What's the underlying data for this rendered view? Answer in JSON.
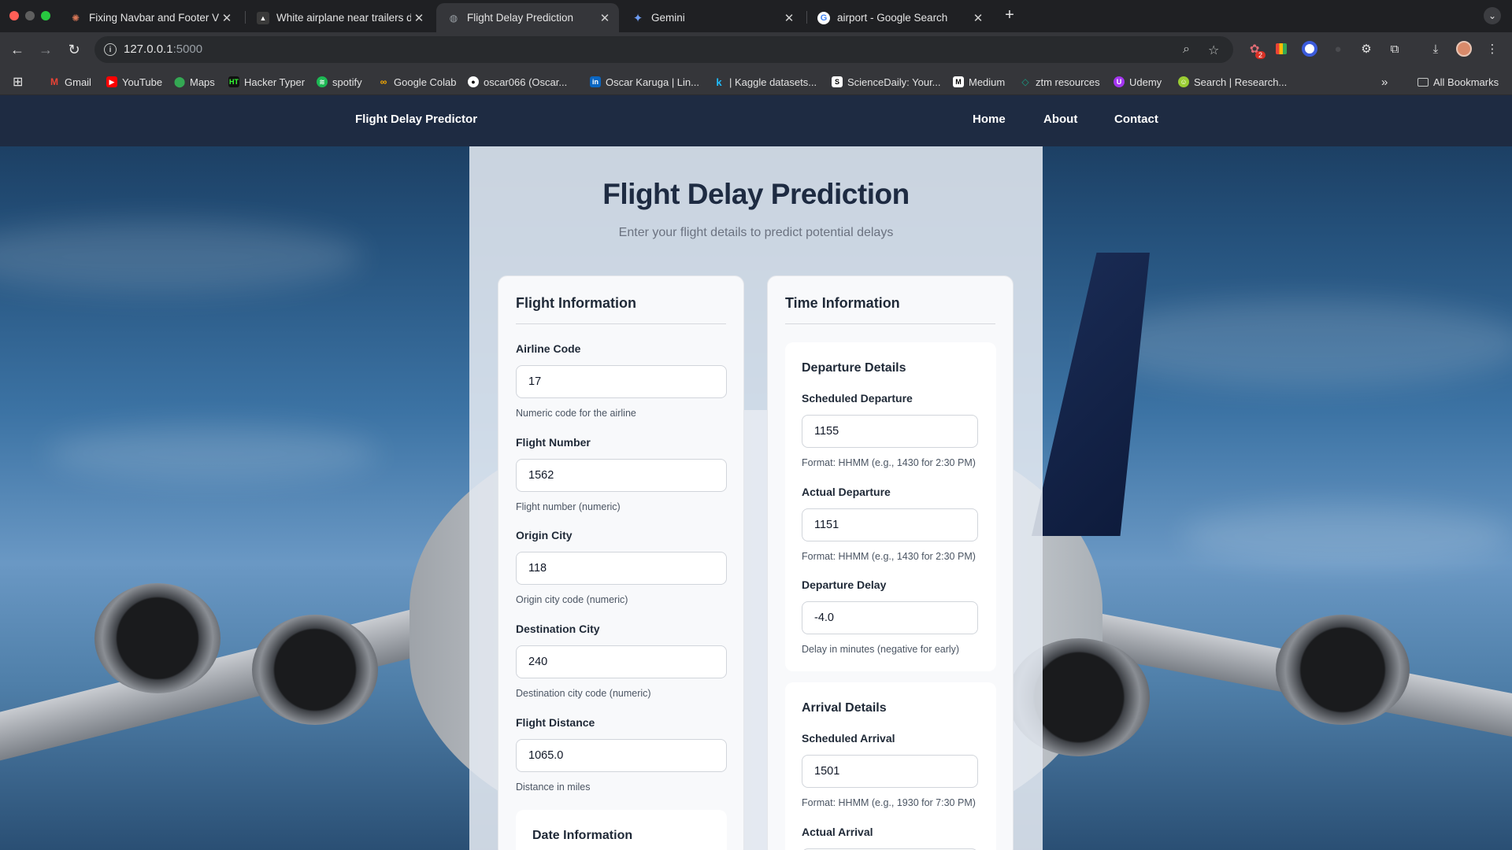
{
  "browser": {
    "tabs": [
      {
        "title": "Fixing Navbar and Footer Visi",
        "favicon": "claude-icon"
      },
      {
        "title": "White airplane near trailers d",
        "favicon": "image-icon"
      },
      {
        "title": "Flight Delay Prediction",
        "favicon": "globe-icon",
        "active": true
      },
      {
        "title": "Gemini",
        "favicon": "gemini-icon"
      },
      {
        "title": "airport - Google Search",
        "favicon": "google-icon"
      }
    ],
    "url_host": "127.0.0.1",
    "url_port": ":5000",
    "bookmarks": [
      {
        "label": "Gmail",
        "color": "#ea4335"
      },
      {
        "label": "YouTube",
        "color": "#ff0000"
      },
      {
        "label": "Maps",
        "color": "#34a853"
      },
      {
        "label": "Hacker Typer",
        "color": "#1a1a1a"
      },
      {
        "label": "spotify",
        "color": "#1db954"
      },
      {
        "label": "Google Colab",
        "color": "#f9ab00"
      },
      {
        "label": "oscar066 (Oscar...",
        "color": "#ffffff"
      },
      {
        "label": "Oscar Karuga | Lin...",
        "color": "#0a66c2"
      },
      {
        "label": "| Kaggle datasets...",
        "color": "#20beff"
      },
      {
        "label": "ScienceDaily: Your...",
        "color": "#ffffff"
      },
      {
        "label": "Medium",
        "color": "#000000"
      },
      {
        "label": "ztm resources",
        "color": "#16a085"
      },
      {
        "label": "Udemy",
        "color": "#a435f0"
      },
      {
        "label": "Search | Research...",
        "color": "#9acd32"
      }
    ],
    "all_bookmarks": "All Bookmarks",
    "extension_badge": "2"
  },
  "site": {
    "brand": "Flight Delay Predictor",
    "nav": [
      "Home",
      "About",
      "Contact"
    ]
  },
  "form": {
    "title": "Flight Delay Prediction",
    "subtitle": "Enter your flight details to predict potential delays",
    "flight_info": {
      "heading": "Flight Information",
      "fields": [
        {
          "label": "Airline Code",
          "value": "17",
          "hint": "Numeric code for the airline"
        },
        {
          "label": "Flight Number",
          "value": "1562",
          "hint": "Flight number (numeric)"
        },
        {
          "label": "Origin City",
          "value": "118",
          "hint": "Origin city code (numeric)"
        },
        {
          "label": "Destination City",
          "value": "240",
          "hint": "Destination city code (numeric)"
        },
        {
          "label": "Flight Distance",
          "value": "1065.0",
          "hint": "Distance in miles"
        }
      ],
      "date_heading": "Date Information"
    },
    "time_info": {
      "heading": "Time Information",
      "departure": {
        "heading": "Departure Details",
        "fields": [
          {
            "label": "Scheduled Departure",
            "value": "1155",
            "hint": "Format: HHMM (e.g., 1430 for 2:30 PM)"
          },
          {
            "label": "Actual Departure",
            "value": "1151",
            "hint": "Format: HHMM (e.g., 1430 for 2:30 PM)"
          },
          {
            "label": "Departure Delay",
            "value": "-4.0",
            "hint": "Delay in minutes (negative for early)"
          }
        ]
      },
      "arrival": {
        "heading": "Arrival Details",
        "fields": [
          {
            "label": "Scheduled Arrival",
            "value": "1501",
            "hint": "Format: HHMM (e.g., 1930 for 7:30 PM)"
          },
          {
            "label": "Actual Arrival",
            "value": ""
          }
        ]
      }
    }
  }
}
